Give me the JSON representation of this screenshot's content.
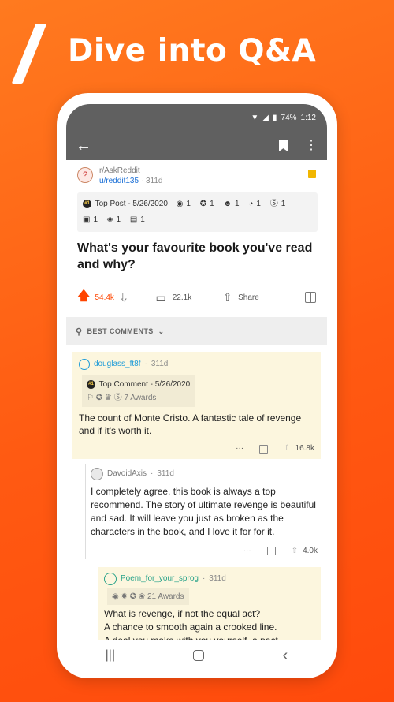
{
  "promo": {
    "title": "Dive into Q&A"
  },
  "status": {
    "battery": "74%",
    "time": "1:12"
  },
  "post": {
    "subreddit": "r/AskReddit",
    "author": "u/reddit135",
    "age": "311d",
    "top_post": "Top Post - 5/26/2020",
    "awards_row1": [
      "1",
      "1",
      "1",
      "1",
      "1"
    ],
    "awards_row2": [
      "1",
      "1",
      "1"
    ],
    "title": "What's your favourite book you've read and why?",
    "score": "54.4k",
    "comments": "22.1k",
    "share": "Share"
  },
  "sort": {
    "label": "BEST COMMENTS"
  },
  "comments": [
    {
      "user": "douglass_ft8f",
      "time": "311d",
      "badge": "Top Comment - 5/26/2020",
      "awards": "7 Awards",
      "body": "The count of Monte Cristo. A fantastic tale of revenge and if it's worth it.",
      "votes": "16.8k"
    },
    {
      "user": "DavoidAxis",
      "time": "311d",
      "body": "I completely agree, this book is always a top recommend.  The story of ultimate revenge is beautiful and sad. It will leave you just as broken as the characters in the book, and I love it for for it.",
      "votes": "4.0k"
    },
    {
      "user": "Poem_for_your_sprog",
      "time": "311d",
      "awards": "21 Awards",
      "lines": [
        "What is revenge, if not the equal act?",
        "A chance to smooth again a crooked line.",
        "A deal you make with you yourself, a pact -"
      ]
    }
  ],
  "colors": {
    "accent": "#ff4500",
    "bar": "#606060",
    "highlight": "#fcf6de"
  },
  "icons": [
    "back-arrow-icon",
    "bookmark-icon",
    "kebab-menu-icon",
    "upvote-icon",
    "downvote-icon",
    "comment-icon",
    "share-icon",
    "gift-icon",
    "rocket-icon"
  ]
}
